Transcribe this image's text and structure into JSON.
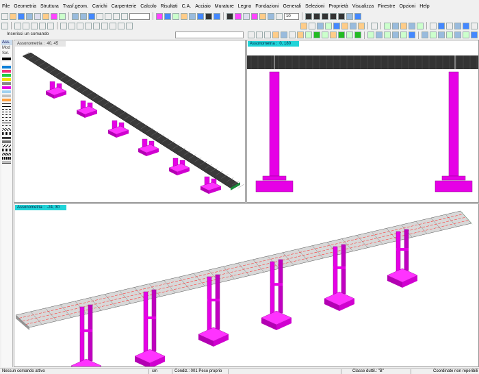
{
  "menu": [
    "File",
    "Geometria",
    "Struttura",
    "Trasf.geom.",
    "Carichi",
    "Carpenterie",
    "Calcolo",
    "Risultati",
    "C.A.",
    "Acciaio",
    "Murature",
    "Legno",
    "Fondazioni",
    "Generali",
    "Selezioni",
    "Proprietà",
    "Visualizza",
    "Finestre",
    "Opzioni",
    "Help"
  ],
  "toolbar": {
    "zoom_value": "10"
  },
  "command": {
    "label": "Inserisci un comando",
    "value": ""
  },
  "palette": {
    "tabs": [
      "Ass.",
      "Mod",
      "Sel."
    ]
  },
  "views": {
    "top_left": {
      "label": "Assonometria :  40, 45"
    },
    "top_right": {
      "label": "Assonometria :  0, 180"
    },
    "bottom": {
      "label": "Assonometria :  -24, 30"
    }
  },
  "status": {
    "message": "Nessun comando attivo",
    "units": "cm",
    "condition": "Condiz.: 001   Peso proprio",
    "class": "Classe duttil.: \"B\"",
    "coords": "Coordinate non reperibili"
  },
  "colors": {
    "pier": "#e600e6",
    "deck": "#444444",
    "grid": "#ff3333",
    "accent": "#20d4d8"
  }
}
